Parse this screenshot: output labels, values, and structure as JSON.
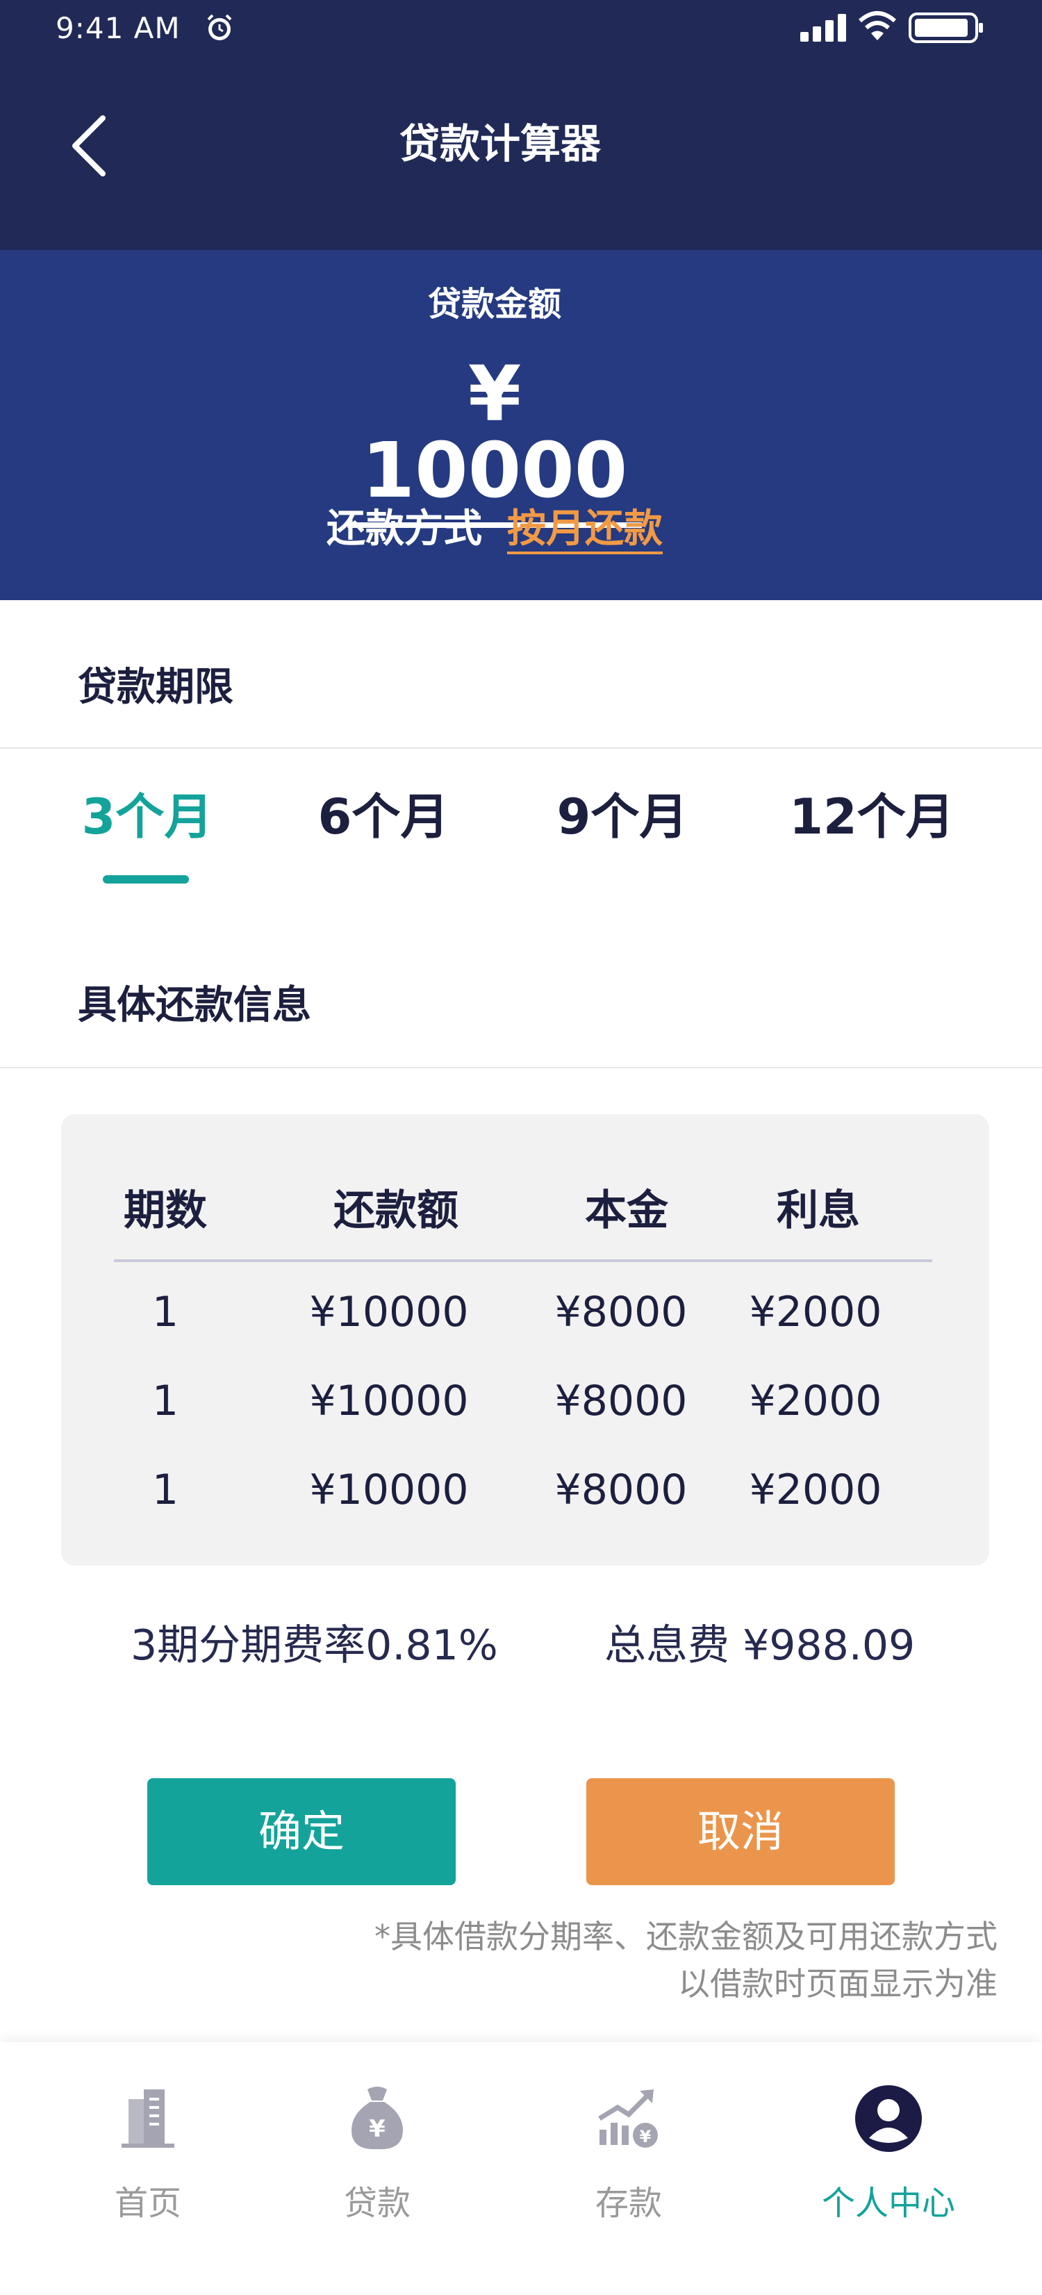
{
  "status_bar": {
    "time": "9:41 AM"
  },
  "nav": {
    "title": "贷款计算器"
  },
  "hero": {
    "amount_label": "贷款金额",
    "amount": "¥ 10000",
    "method_label": "还款方式",
    "method_value": "按月还款"
  },
  "term": {
    "title": "贷款期限",
    "tabs": [
      "3个月",
      "6个月",
      "9个月",
      "12个月"
    ],
    "selected": "3个月"
  },
  "detail": {
    "title": "具体还款信息",
    "headers": [
      "期数",
      "还款额",
      "本金",
      "利息"
    ],
    "rows": [
      [
        "1",
        "¥10000",
        "¥8000",
        "¥2000"
      ],
      [
        "1",
        "¥10000",
        "¥8000",
        "¥2000"
      ],
      [
        "1",
        "¥10000",
        "¥8000",
        "¥2000"
      ]
    ]
  },
  "summary": {
    "rate_text": "3期分期费率0.81%",
    "interest_text": "总息费 ¥988.09"
  },
  "actions": {
    "confirm": "确定",
    "cancel": "取消"
  },
  "note": {
    "line1": "*具体借款分期率、还款金额及可用还款方式",
    "line2": "以借款时页面显示为准"
  },
  "tabbar": {
    "items": [
      {
        "label": "首页",
        "icon": "building-icon"
      },
      {
        "label": "贷款",
        "icon": "money-bag-icon"
      },
      {
        "label": "存款",
        "icon": "growth-chart-icon"
      },
      {
        "label": "个人中心",
        "icon": "user-profile-icon"
      }
    ],
    "active": "个人中心"
  },
  "colors": {
    "nav_bg": "#212a56",
    "hero_bg": "#253a80",
    "accent_teal": "#13a39a",
    "accent_orange": "#ea954b",
    "method_orange": "#f19a45"
  }
}
